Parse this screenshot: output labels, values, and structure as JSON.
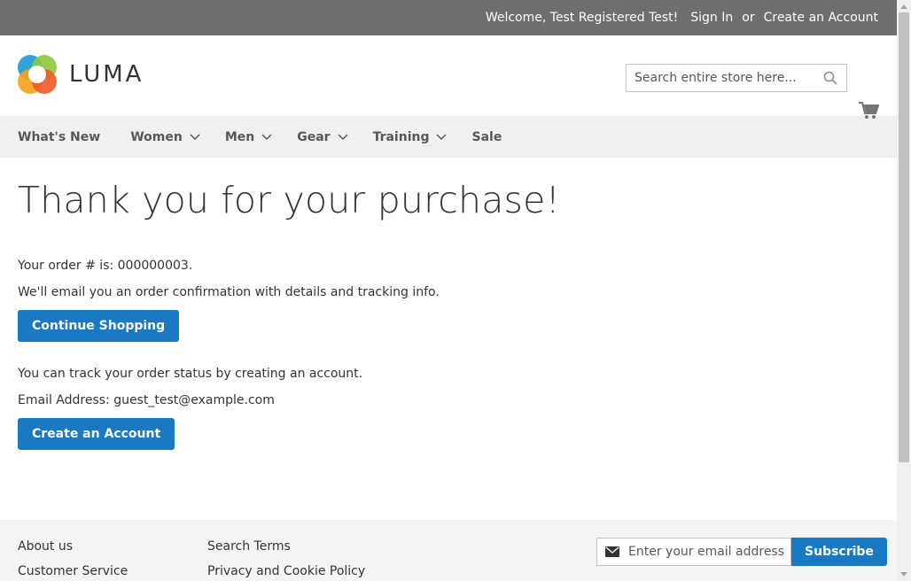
{
  "topbar": {
    "welcome": "Welcome, Test Registered Test!",
    "sign_in": "Sign In",
    "or": "or",
    "create_account": "Create an Account"
  },
  "header": {
    "logo_text": "LUMA",
    "search_placeholder": "Search entire store here..."
  },
  "nav": {
    "items": [
      {
        "label": "What's New",
        "has_dropdown": false
      },
      {
        "label": "Women",
        "has_dropdown": true
      },
      {
        "label": "Men",
        "has_dropdown": true
      },
      {
        "label": "Gear",
        "has_dropdown": true
      },
      {
        "label": "Training",
        "has_dropdown": true
      },
      {
        "label": "Sale",
        "has_dropdown": false
      }
    ]
  },
  "main": {
    "title": "Thank you for your purchase!",
    "order_text": "Your order # is: 000000003.",
    "email_text": "We'll email you an order confirmation with details and tracking info.",
    "continue_button": "Continue Shopping",
    "track_text": "You can track your order status by creating an account.",
    "email_address_text": "Email Address: guest_test@example.com",
    "create_button": "Create an Account"
  },
  "footer": {
    "col1": [
      "About us",
      "Customer Service"
    ],
    "col2": [
      "Search Terms",
      "Privacy and Cookie Policy"
    ],
    "newsletter_placeholder": "Enter your email address",
    "subscribe_button": "Subscribe"
  },
  "colors": {
    "topbar_bg": "#6e6e6c",
    "nav_bg": "#f0f0f0",
    "primary_button": "#1979c3",
    "footer_bg": "#f4f4f4"
  },
  "icons": [
    "search-icon",
    "cart-icon",
    "chevron-down-icon",
    "mail-icon"
  ]
}
